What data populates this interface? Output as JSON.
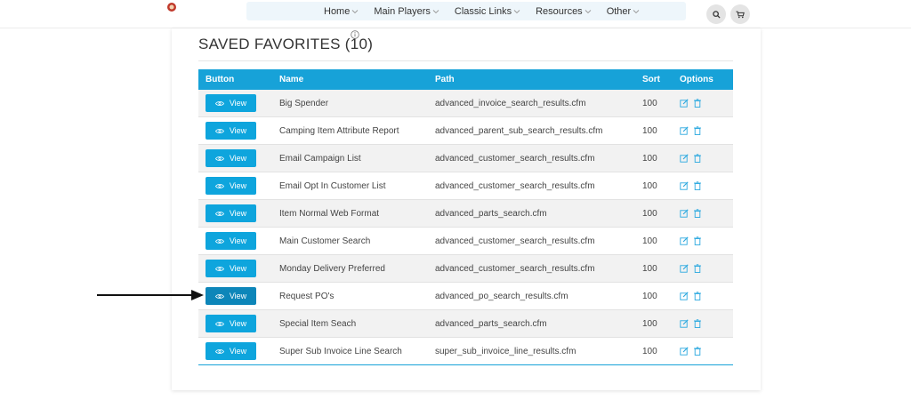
{
  "nav": {
    "items": [
      {
        "label": "Home",
        "name": "nav-home"
      },
      {
        "label": "Main Players",
        "name": "nav-main-players"
      },
      {
        "label": "Classic Links",
        "name": "nav-classic-links"
      },
      {
        "label": "Resources",
        "name": "nav-resources"
      },
      {
        "label": "Other",
        "name": "nav-other"
      }
    ]
  },
  "page": {
    "title": "SAVED FAVORITES (10)"
  },
  "table": {
    "headers": {
      "button": "Button",
      "name": "Name",
      "path": "Path",
      "sort": "Sort",
      "options": "Options"
    },
    "view_label": "View",
    "rows": [
      {
        "name": "Big Spender",
        "path": "advanced_invoice_search_results.cfm",
        "sort": "100"
      },
      {
        "name": "Camping Item Attribute Report",
        "path": "advanced_parent_sub_search_results.cfm",
        "sort": "100"
      },
      {
        "name": "Email Campaign List",
        "path": "advanced_customer_search_results.cfm",
        "sort": "100"
      },
      {
        "name": "Email Opt In Customer List",
        "path": "advanced_customer_search_results.cfm",
        "sort": "100"
      },
      {
        "name": "Item Normal Web Format",
        "path": "advanced_parts_search.cfm",
        "sort": "100"
      },
      {
        "name": "Main Customer Search",
        "path": "advanced_customer_search_results.cfm",
        "sort": "100"
      },
      {
        "name": "Monday Delivery Preferred",
        "path": "advanced_customer_search_results.cfm",
        "sort": "100"
      },
      {
        "name": "Request PO's",
        "path": "advanced_po_search_results.cfm",
        "sort": "100"
      },
      {
        "name": "Special Item Seach",
        "path": "advanced_parts_search.cfm",
        "sort": "100"
      },
      {
        "name": "Super Sub Invoice Line Search",
        "path": "super_sub_invoice_line_results.cfm",
        "sort": "100"
      }
    ]
  },
  "colors": {
    "accent": "#17a2d8",
    "button": "#0ea5dd",
    "button_active": "#0d86b9"
  },
  "icons": {
    "logo": "brand-logo-icon",
    "search": "search-icon",
    "cart": "cart-icon",
    "info": "info-icon",
    "eye": "eye-icon",
    "edit": "edit-icon",
    "delete": "trash-icon",
    "arrow": "pointer-arrow-icon"
  }
}
